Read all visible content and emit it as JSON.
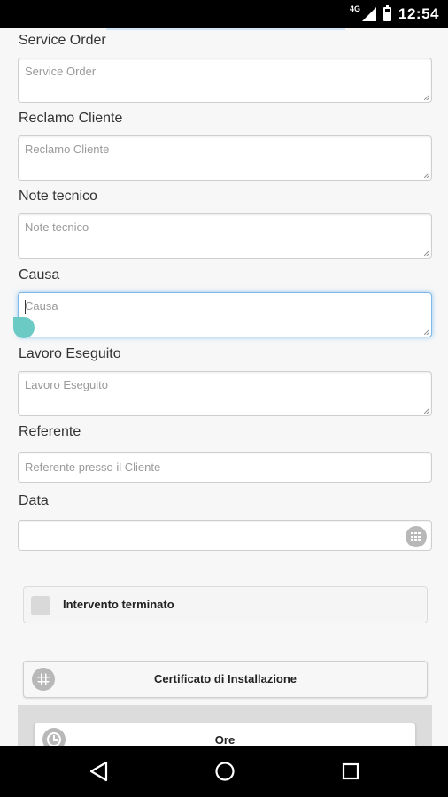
{
  "status_bar": {
    "network": "4G",
    "time": "12:54"
  },
  "form": {
    "service_order": {
      "label": "Service Order",
      "placeholder": "Service Order"
    },
    "reclamo_cliente": {
      "label": "Reclamo Cliente",
      "placeholder": "Reclamo Cliente"
    },
    "note_tecnico": {
      "label": "Note tecnico",
      "placeholder": "Note tecnico"
    },
    "causa": {
      "label": "Causa",
      "placeholder": "Causa"
    },
    "lavoro_eseguito": {
      "label": "Lavoro Eseguito",
      "placeholder": "Lavoro Eseguito"
    },
    "referente": {
      "label": "Referente",
      "placeholder": "Referente presso il Cliente"
    },
    "data": {
      "label": "Data",
      "value": ""
    }
  },
  "checkbox": {
    "label": "Intervento terminato",
    "checked": false
  },
  "buttons": {
    "certificato": "Certificato di Installazione",
    "ore": "Ore"
  },
  "colors": {
    "accent_focus": "#7fb7e6",
    "handle": "#6ccac4",
    "icon_gray": "#b8b8b8"
  }
}
